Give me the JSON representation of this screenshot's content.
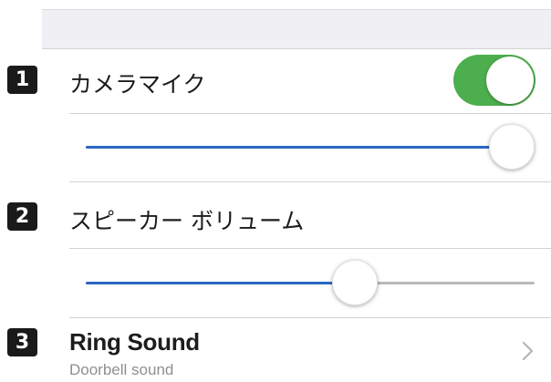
{
  "header": {
    "title": ""
  },
  "settings": {
    "camera_mic": {
      "number": "1",
      "label": "カメラマイク",
      "enabled": true,
      "level": 1.0
    },
    "speaker_volume": {
      "number": "2",
      "label": "スピーカー ボリューム",
      "level": 0.6
    },
    "ring_sound": {
      "number": "3",
      "title": "Ring Sound",
      "subtitle": "Doorbell sound"
    }
  },
  "colors": {
    "toggle_on": "#4cae4c",
    "slider_fill": "#2b67c4",
    "slider_track": "#b9b9b9",
    "badge": "#1a1a1a",
    "background_band": "#efeff4"
  },
  "icons": {
    "chevron": "chevron-right-icon"
  }
}
